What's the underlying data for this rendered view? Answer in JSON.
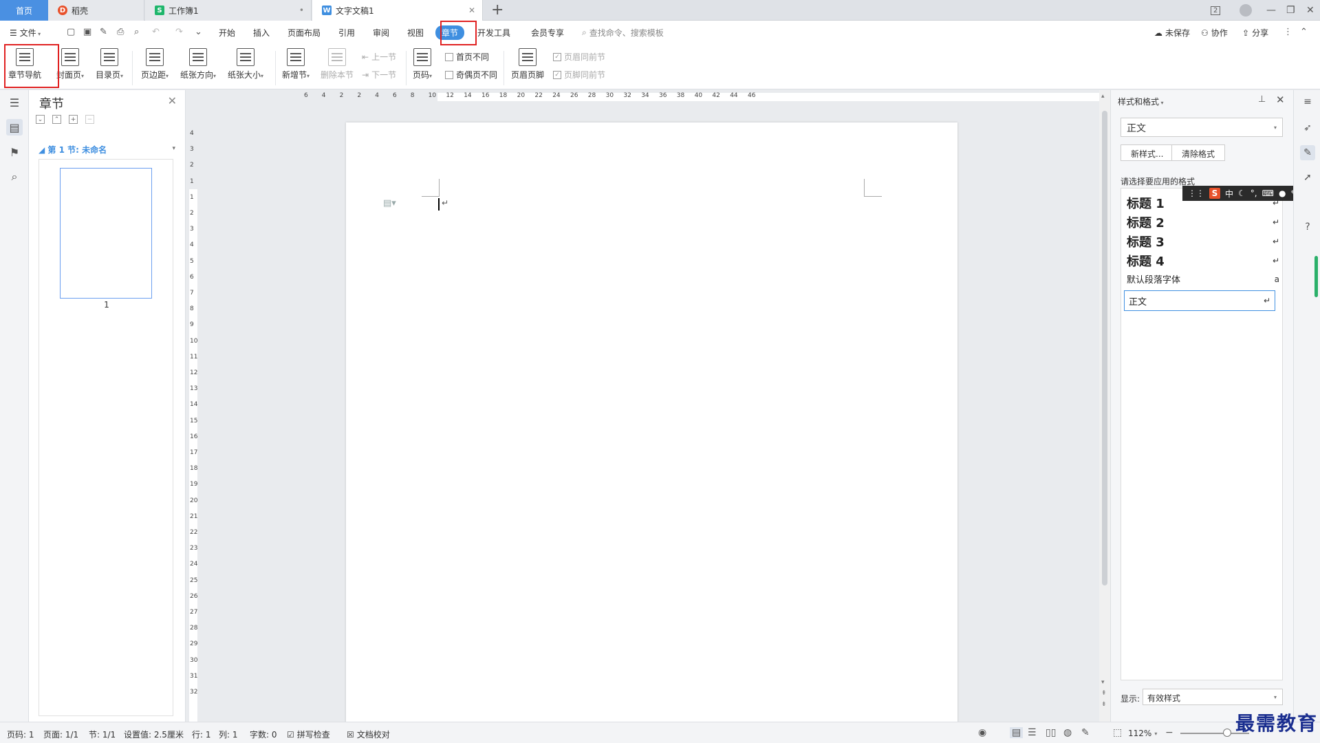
{
  "tabs": {
    "home": "首页",
    "docs": [
      {
        "label": "稻壳",
        "icon": "daoke-icon"
      },
      {
        "label": "工作簿1",
        "icon": "spreadsheet-icon"
      },
      {
        "label": "文字文稿1",
        "icon": "writer-icon"
      }
    ],
    "window_badge": "2"
  },
  "menu": {
    "file": "文件",
    "items": [
      "开始",
      "插入",
      "页面布局",
      "引用",
      "审阅",
      "视图",
      "章节",
      "开发工具",
      "会员专享"
    ],
    "active_index": 6,
    "search_placeholder": "查找命令、搜索模板",
    "unsaved": "未保存",
    "collaborate": "协作",
    "share": "分享"
  },
  "ribbon": {
    "chapter_nav": "章节导航",
    "cover": "封面页",
    "toc": "目录页",
    "margin": "页边距",
    "orientation": "纸张方向",
    "paper_size": "纸张大小",
    "new_section": "新增节",
    "delete_section": "删除本节",
    "prev_section": "上一节",
    "next_section": "下一节",
    "page_number": "页码",
    "first_page_diff": "首页不同",
    "odd_even_diff": "奇偶页不同",
    "header_footer": "页眉页脚",
    "header_same": "页眉同前节",
    "footer_same": "页脚同前节"
  },
  "chapter_pane": {
    "title": "章节",
    "section_label": "第 1 节: 未命名",
    "page_number": "1"
  },
  "rulers": {
    "horizontal": [
      "6",
      "4",
      "2",
      "2",
      "4",
      "6",
      "8",
      "10",
      "12",
      "14",
      "16",
      "18",
      "20",
      "22",
      "24",
      "26",
      "28",
      "30",
      "32",
      "34",
      "36",
      "38",
      "40",
      "42",
      "44",
      "46"
    ],
    "vertical": [
      "4",
      "3",
      "2",
      "1",
      "1",
      "2",
      "3",
      "4",
      "5",
      "6",
      "7",
      "8",
      "9",
      "10",
      "11",
      "12",
      "13",
      "14",
      "15",
      "16",
      "17",
      "18",
      "19",
      "20",
      "21",
      "22",
      "23",
      "24",
      "25",
      "26",
      "27",
      "28",
      "29",
      "30",
      "31",
      "32"
    ]
  },
  "style_panel": {
    "title": "样式和格式",
    "current_style": "正文",
    "new_style": "新样式...",
    "clear_format": "清除格式",
    "hint": "请选择要应用的格式",
    "styles": [
      {
        "label": "标题  1",
        "mark": "↵",
        "kind": "heading"
      },
      {
        "label": "标题  2",
        "mark": "↵",
        "kind": "heading"
      },
      {
        "label": "标题  3",
        "mark": "↵",
        "kind": "heading"
      },
      {
        "label": "标题  4",
        "mark": "↵",
        "kind": "heading"
      },
      {
        "label": "默认段落字体",
        "mark": "a",
        "kind": "plain"
      },
      {
        "label": "正文",
        "mark": "↵",
        "kind": "selected"
      }
    ],
    "show_label": "显示:",
    "show_value": "有效样式"
  },
  "ime": {
    "logo": "S",
    "mode": "中"
  },
  "status": {
    "page_code": "页码: 1",
    "pages": "页面: 1/1",
    "section": "节: 1/1",
    "setting": "设置值: 2.5厘米",
    "row": "行: 1",
    "col": "列: 1",
    "words": "字数: 0",
    "spell": "拼写检查",
    "proof": "文档校对",
    "zoom": "112%"
  },
  "watermark": "最需教育",
  "colors": {
    "accent": "#3f8fe0",
    "highlight": "#e02020",
    "home_tab": "#4a90e2"
  }
}
